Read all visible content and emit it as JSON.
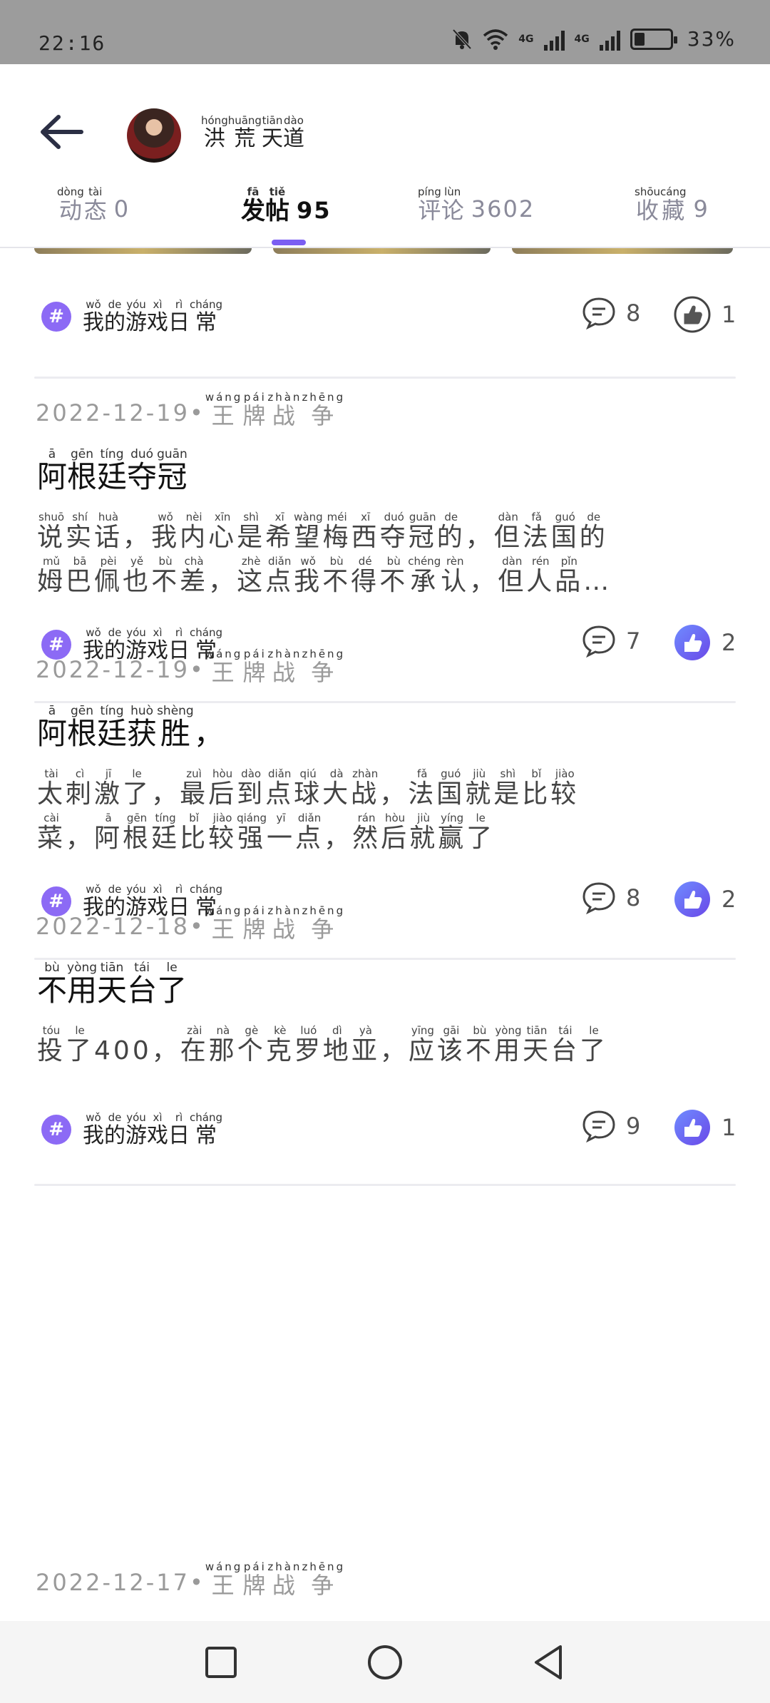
{
  "status_bar": {
    "time": "22:16",
    "network": "4G",
    "battery": "33%"
  },
  "header": {
    "username": [
      {
        "hz": "洪",
        "py": "hóng"
      },
      {
        "hz": "荒",
        "py": "huāng"
      },
      {
        "hz": "天",
        "py": "tiān"
      },
      {
        "hz": "道",
        "py": "dào"
      }
    ],
    "tabs": [
      {
        "chars": [
          {
            "hz": "动",
            "py": "dòng"
          },
          {
            "hz": "态",
            "py": "tài"
          }
        ],
        "count": "0"
      },
      {
        "chars": [
          {
            "hz": "发",
            "py": "fā"
          },
          {
            "hz": "帖",
            "py": "tiě"
          }
        ],
        "count": "95",
        "active": true
      },
      {
        "chars": [
          {
            "hz": "评",
            "py": "píng"
          },
          {
            "hz": "论",
            "py": "lùn"
          }
        ],
        "count": "3602"
      },
      {
        "chars": [
          {
            "hz": "收",
            "py": "shōu"
          },
          {
            "hz": "藏",
            "py": "cáng"
          }
        ],
        "count": "9"
      }
    ]
  },
  "tag": [
    {
      "hz": "我",
      "py": "wǒ"
    },
    {
      "hz": "的",
      "py": "de"
    },
    {
      "hz": "游",
      "py": "yóu"
    },
    {
      "hz": "戏",
      "py": "xì"
    },
    {
      "hz": "日",
      "py": "rì"
    },
    {
      "hz": "常",
      "py": "cháng"
    }
  ],
  "category": [
    {
      "hz": "王",
      "py": "wáng"
    },
    {
      "hz": "牌",
      "py": "pái"
    },
    {
      "hz": "战",
      "py": "zhàn"
    },
    {
      "hz": "争",
      "py": "zhēng"
    }
  ],
  "first_post_stats": {
    "comments": "8",
    "likes": "1"
  },
  "posts": [
    {
      "date": "2022-12-19",
      "title": [
        {
          "hz": "阿",
          "py": "ā"
        },
        {
          "hz": "根",
          "py": "gēn"
        },
        {
          "hz": "廷",
          "py": "tíng"
        },
        {
          "hz": "夺",
          "py": "duó"
        },
        {
          "hz": "冠",
          "py": "guān"
        }
      ],
      "lines": [
        [
          {
            "hz": "说",
            "py": "shuō"
          },
          {
            "hz": "实",
            "py": "shí"
          },
          {
            "hz": "话",
            "py": "huà"
          },
          {
            "hz": "，",
            "py": ""
          },
          {
            "hz": "我",
            "py": "wǒ"
          },
          {
            "hz": "内",
            "py": "nèi"
          },
          {
            "hz": "心",
            "py": "xīn"
          },
          {
            "hz": "是",
            "py": "shì"
          },
          {
            "hz": "希",
            "py": "xī"
          },
          {
            "hz": "望",
            "py": "wàng"
          },
          {
            "hz": "梅",
            "py": "méi"
          },
          {
            "hz": "西",
            "py": "xī"
          },
          {
            "hz": "夺",
            "py": "duó"
          },
          {
            "hz": "冠",
            "py": "guān"
          },
          {
            "hz": "的",
            "py": "de"
          },
          {
            "hz": "，",
            "py": ""
          },
          {
            "hz": "但",
            "py": "dàn"
          },
          {
            "hz": "法",
            "py": "fǎ"
          },
          {
            "hz": "国",
            "py": "guó"
          },
          {
            "hz": "的",
            "py": "de"
          }
        ],
        [
          {
            "hz": "姆",
            "py": "mǔ"
          },
          {
            "hz": "巴",
            "py": "bā"
          },
          {
            "hz": "佩",
            "py": "pèi"
          },
          {
            "hz": "也",
            "py": "yě"
          },
          {
            "hz": "不",
            "py": "bù"
          },
          {
            "hz": "差",
            "py": "chà"
          },
          {
            "hz": "，",
            "py": ""
          },
          {
            "hz": "这",
            "py": "zhè"
          },
          {
            "hz": "点",
            "py": "diǎn"
          },
          {
            "hz": "我",
            "py": "wǒ"
          },
          {
            "hz": "不",
            "py": "bù"
          },
          {
            "hz": "得",
            "py": "dé"
          },
          {
            "hz": "不",
            "py": "bù"
          },
          {
            "hz": "承",
            "py": "chéng"
          },
          {
            "hz": "认",
            "py": "rèn"
          },
          {
            "hz": "，",
            "py": ""
          },
          {
            "hz": "但",
            "py": "dàn"
          },
          {
            "hz": "人",
            "py": "rén"
          },
          {
            "hz": "品",
            "py": "pǐn"
          },
          {
            "hz": "…",
            "py": ""
          }
        ]
      ],
      "comments": "7",
      "likes": "2"
    },
    {
      "date": "2022-12-19",
      "title": [
        {
          "hz": "阿",
          "py": "ā"
        },
        {
          "hz": "根",
          "py": "gēn"
        },
        {
          "hz": "廷",
          "py": "tíng"
        },
        {
          "hz": "获",
          "py": "huò"
        },
        {
          "hz": "胜",
          "py": "shèng"
        },
        {
          "hz": "，",
          "py": ""
        }
      ],
      "lines": [
        [
          {
            "hz": "太",
            "py": "tài"
          },
          {
            "hz": "刺",
            "py": "cì"
          },
          {
            "hz": "激",
            "py": "jī"
          },
          {
            "hz": "了",
            "py": "le"
          },
          {
            "hz": "，",
            "py": ""
          },
          {
            "hz": "最",
            "py": "zuì"
          },
          {
            "hz": "后",
            "py": "hòu"
          },
          {
            "hz": "到",
            "py": "dào"
          },
          {
            "hz": "点",
            "py": "diǎn"
          },
          {
            "hz": "球",
            "py": "qiú"
          },
          {
            "hz": "大",
            "py": "dà"
          },
          {
            "hz": "战",
            "py": "zhàn"
          },
          {
            "hz": "，",
            "py": ""
          },
          {
            "hz": "法",
            "py": "fǎ"
          },
          {
            "hz": "国",
            "py": "guó"
          },
          {
            "hz": "就",
            "py": "jiù"
          },
          {
            "hz": "是",
            "py": "shì"
          },
          {
            "hz": "比",
            "py": "bǐ"
          },
          {
            "hz": "较",
            "py": "jiào"
          }
        ],
        [
          {
            "hz": "菜",
            "py": "cài"
          },
          {
            "hz": "，",
            "py": ""
          },
          {
            "hz": "阿",
            "py": "ā"
          },
          {
            "hz": "根",
            "py": "gēn"
          },
          {
            "hz": "廷",
            "py": "tíng"
          },
          {
            "hz": "比",
            "py": "bǐ"
          },
          {
            "hz": "较",
            "py": "jiào"
          },
          {
            "hz": "强",
            "py": "qiáng"
          },
          {
            "hz": "一",
            "py": "yī"
          },
          {
            "hz": "点",
            "py": "diǎn"
          },
          {
            "hz": "，",
            "py": ""
          },
          {
            "hz": "然",
            "py": "rán"
          },
          {
            "hz": "后",
            "py": "hòu"
          },
          {
            "hz": "就",
            "py": "jiù"
          },
          {
            "hz": "赢",
            "py": "yíng"
          },
          {
            "hz": "了",
            "py": "le"
          }
        ]
      ],
      "comments": "8",
      "likes": "2"
    },
    {
      "date": "2022-12-18",
      "title": [
        {
          "hz": "不",
          "py": "bù"
        },
        {
          "hz": "用",
          "py": "yòng"
        },
        {
          "hz": "天",
          "py": "tiān"
        },
        {
          "hz": "台",
          "py": "tái"
        },
        {
          "hz": "了",
          "py": "le"
        }
      ],
      "lines": [
        [
          {
            "hz": "投",
            "py": "tóu"
          },
          {
            "hz": "了",
            "py": "le"
          },
          {
            "hz": "400",
            "py": ""
          },
          {
            "hz": "，",
            "py": ""
          },
          {
            "hz": "在",
            "py": "zài"
          },
          {
            "hz": "那",
            "py": "nà"
          },
          {
            "hz": "个",
            "py": "gè"
          },
          {
            "hz": "克",
            "py": "kè"
          },
          {
            "hz": "罗",
            "py": "luó"
          },
          {
            "hz": "地",
            "py": "dì"
          },
          {
            "hz": "亚",
            "py": "yà"
          },
          {
            "hz": "，",
            "py": ""
          },
          {
            "hz": "应",
            "py": "yīng"
          },
          {
            "hz": "该",
            "py": "gāi"
          },
          {
            "hz": "不",
            "py": "bù"
          },
          {
            "hz": "用",
            "py": "yòng"
          },
          {
            "hz": "天",
            "py": "tiān"
          },
          {
            "hz": "台",
            "py": "tái"
          },
          {
            "hz": "了",
            "py": "le"
          }
        ]
      ],
      "comments": "9",
      "likes": "1"
    }
  ],
  "partial_post": {
    "date": "2022-12-17"
  },
  "colors": {
    "accent": "#7b5ef2",
    "tag_bg": "#8c6af5",
    "muted": "#9a9a9a"
  }
}
